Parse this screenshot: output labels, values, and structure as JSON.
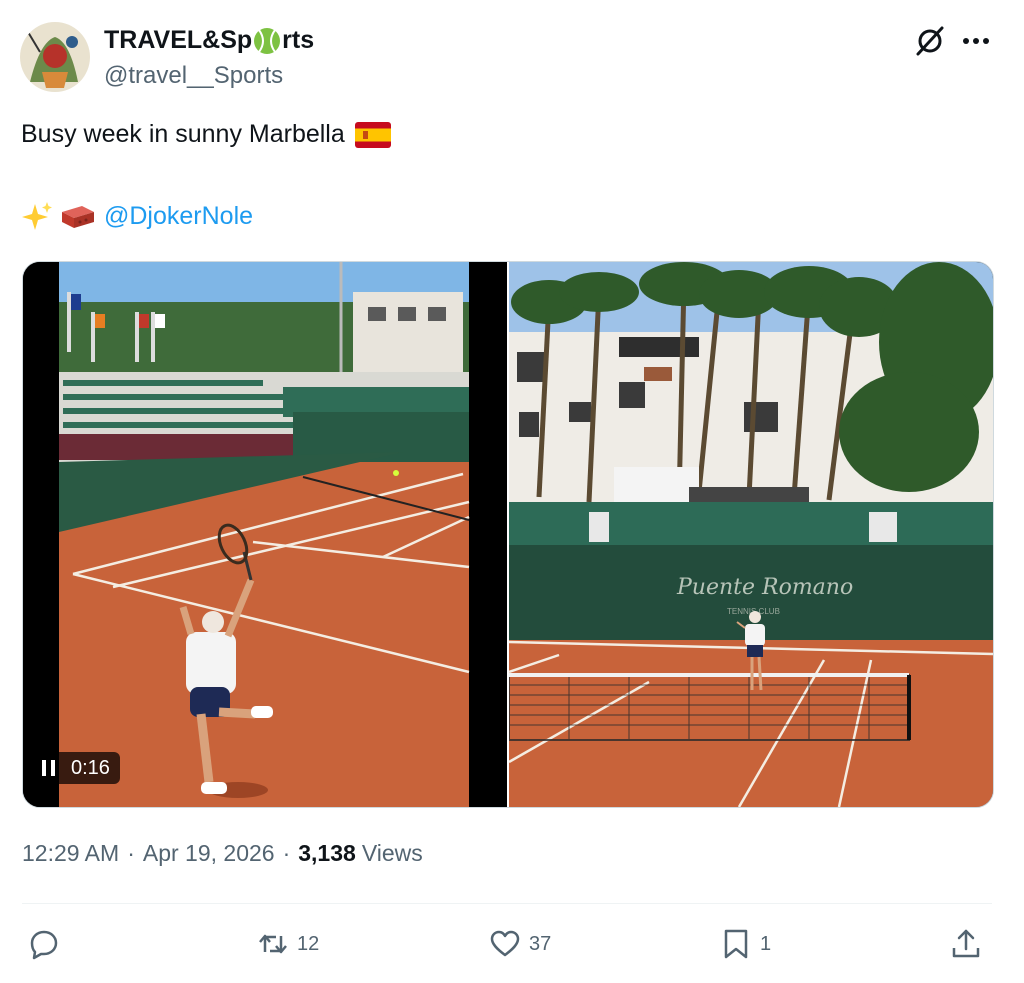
{
  "author": {
    "display_name_before": "TRAVEL&Sp",
    "display_name_after": "rts",
    "handle": "@travel__Sports"
  },
  "tweet": {
    "text": "Busy week in sunny Marbella",
    "mention": "@DjokerNole"
  },
  "media": {
    "video_time": "0:16",
    "banner_text": "Puente Romano",
    "banner_subtext": "TENNIS CLUB"
  },
  "meta": {
    "time": "12:29 AM",
    "date": "Apr 19, 2026",
    "views_count": "3,138",
    "views_label": "Views"
  },
  "actions": {
    "reply_count": "",
    "retweet_count": "12",
    "like_count": "37",
    "bookmark_count": "1"
  },
  "colors": {
    "accent": "#1d9bf0",
    "secondary_text": "#536471",
    "clay": "#c8633a"
  },
  "icons": [
    "avatar",
    "tennis-ball-icon",
    "grok-icon",
    "more-icon",
    "spain-flag-icon",
    "sparkles-icon",
    "brick-icon",
    "pause-icon",
    "reply-icon",
    "retweet-icon",
    "like-icon",
    "bookmark-icon",
    "share-icon"
  ]
}
